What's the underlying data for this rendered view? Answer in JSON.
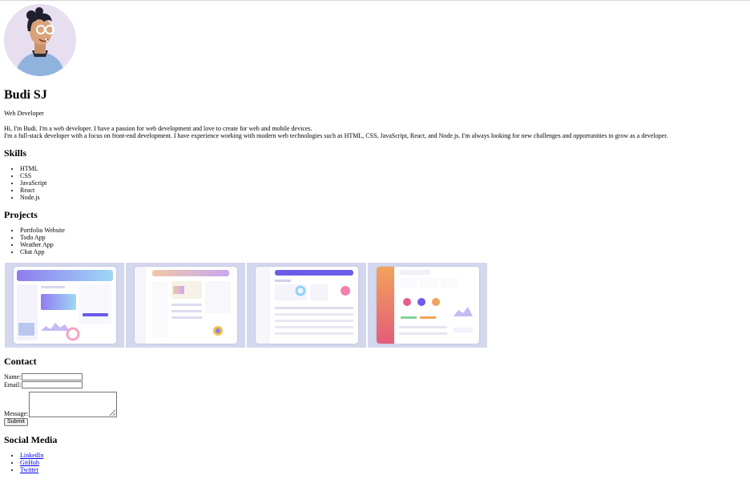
{
  "profile": {
    "name": "Budi SJ",
    "role": "Web Developer",
    "about_line1": "Hi, I'm Budi. I'm a web developer. I have a passion for web development and love to create for web and mobile devices.",
    "about_line2": "I'm a full-stack developer with a focus on front-end development. I have experience working with modern web technologies such as HTML, CSS, JavaScript, React, and Node.js. I'm always looking for new challenges and opportunities to grow as a developer."
  },
  "skills": {
    "heading": "Skills",
    "items": [
      "HTML",
      "CSS",
      "JavaScript",
      "React",
      "Node.js"
    ]
  },
  "projects": {
    "heading": "Projects",
    "items": [
      "Portfolio Website",
      "Todo App",
      "Weather App",
      "Chat App"
    ]
  },
  "contact": {
    "heading": "Contact",
    "name_label": "Name:",
    "name_value": "",
    "email_label": "Email:",
    "email_value": "",
    "message_label": "Message:",
    "message_value": "",
    "submit_label": "Submit"
  },
  "social": {
    "heading": "Social Media",
    "links": [
      "LinkedIn",
      "GitHub",
      "Twitter"
    ]
  },
  "colors": {
    "link": "#0000ee",
    "thumb_bg": "#d4d8ee",
    "accent_purple": "#6c5ce7"
  }
}
